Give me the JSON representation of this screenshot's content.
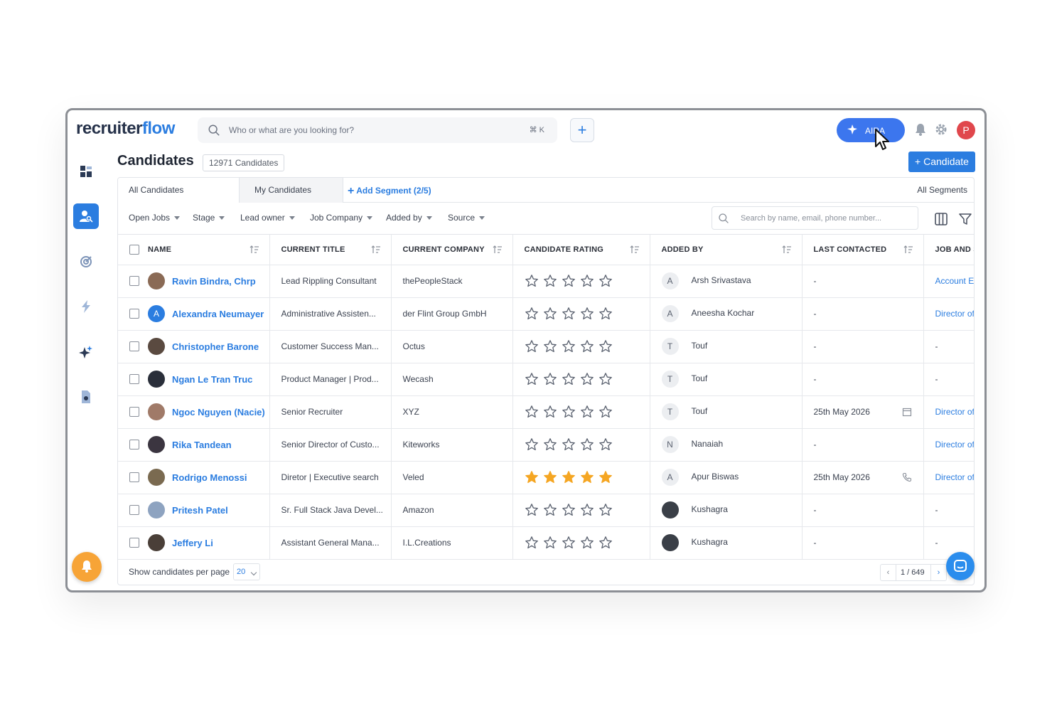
{
  "app": {
    "logo_main": "recruiter",
    "logo_accent": "flow",
    "search_placeholder": "Who or what are you looking for?",
    "search_shortcut": "⌘ K",
    "aira_label": "AIRA",
    "user_initial": "P"
  },
  "page": {
    "title": "Candidates",
    "count": "12971 Candidates",
    "add_button": "+ Candidate"
  },
  "tabs": {
    "all": "All Candidates",
    "mine": "My Candidates",
    "add_segment": "Add Segment (2/5)",
    "all_segments": "All Segments"
  },
  "filters": [
    "Open Jobs",
    "Stage",
    "Lead owner",
    "Job Company",
    "Added by",
    "Source"
  ],
  "table_search_placeholder": "Search by name, email, phone number...",
  "columns": {
    "name": "NAME",
    "title": "CURRENT TITLE",
    "company": "CURRENT COMPANY",
    "rating": "CANDIDATE RATING",
    "added_by": "ADDED BY",
    "last_contacted": "LAST CONTACTED",
    "job": "JOB AND S"
  },
  "rows": [
    {
      "name": "Ravin Bindra, Chrp",
      "title": "Lead Rippling Consultant",
      "company": "thePeopleStack",
      "rating": 0,
      "added_by_initial": "A",
      "added_by": "Arsh Srivastava",
      "last_contacted": "-",
      "job": "Account E"
    },
    {
      "name": "Alexandra Neumayer",
      "title": "Administrative Assisten...",
      "company": "der Flint Group GmbH",
      "rating": 0,
      "added_by_initial": "A",
      "added_by": "Aneesha Kochar",
      "last_contacted": "-",
      "job": "Director of"
    },
    {
      "name": "Christopher Barone",
      "title": "Customer Success Man...",
      "company": "Octus",
      "rating": 0,
      "added_by_initial": "T",
      "added_by": "Touf",
      "last_contacted": "-",
      "job": "-"
    },
    {
      "name": "Ngan Le Tran Truc",
      "title": "Product Manager | Prod...",
      "company": "Wecash",
      "rating": 0,
      "added_by_initial": "T",
      "added_by": "Touf",
      "last_contacted": "-",
      "job": "-"
    },
    {
      "name": "Ngoc Nguyen (Nacie)",
      "title": "Senior Recruiter",
      "company": "XYZ",
      "rating": 0,
      "added_by_initial": "T",
      "added_by": "Touf",
      "last_contacted": "25th May 2026",
      "job": "Director of"
    },
    {
      "name": "Rika Tandean",
      "title": "Senior Director of Custo...",
      "company": "Kiteworks",
      "rating": 0,
      "added_by_initial": "N",
      "added_by": "Nanaiah",
      "last_contacted": "-",
      "job": "Director of"
    },
    {
      "name": "Rodrigo Menossi",
      "title": "Diretor | Executive search",
      "company": "Veled",
      "rating": 5,
      "added_by_initial": "A",
      "added_by": "Apur Biswas",
      "last_contacted": "25th May 2026",
      "job": "Director of"
    },
    {
      "name": "Pritesh Patel",
      "title": "Sr. Full Stack Java Devel...",
      "company": "Amazon",
      "rating": 0,
      "added_by_initial": "",
      "added_by": "Kushagra",
      "last_contacted": "-",
      "job": "-"
    },
    {
      "name": "Jeffery Li",
      "title": "Assistant General Mana...",
      "company": "I.L.Creations",
      "rating": 0,
      "added_by_initial": "",
      "added_by": "Kushagra",
      "last_contacted": "-",
      "job": "-"
    }
  ],
  "footer": {
    "per_page_label": "Show candidates per page",
    "per_page_value": "20",
    "pagination": "1 / 649"
  },
  "colors": {
    "accent": "#2b7de0",
    "star_filled": "#f5a623",
    "aira": "#3c76ee",
    "avatar_user": "#e0474c",
    "notification_fab": "#f7a437"
  }
}
